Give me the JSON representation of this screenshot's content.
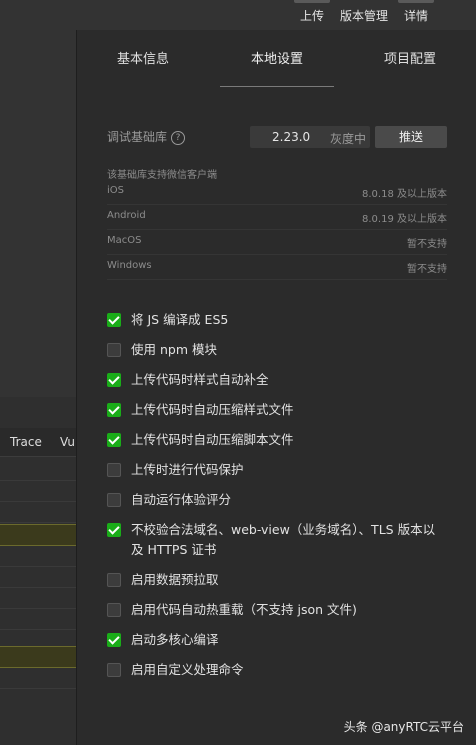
{
  "toolbar": {
    "upload_label": "上传",
    "version_label": "版本管理",
    "detail_label": "详情"
  },
  "left": {
    "tab_trace": "Trace",
    "tab_vu": "Vu"
  },
  "tabs": [
    {
      "label": "基本信息"
    },
    {
      "label": "本地设置"
    },
    {
      "label": "项目配置"
    }
  ],
  "sdk": {
    "label": "调试基础库",
    "help": "?",
    "version": "2.23.0",
    "gray": "灰度中",
    "push_label": "推送"
  },
  "support": {
    "title": "该基础库支持微信客户端",
    "rows": [
      {
        "name": "iOS",
        "status": "8.0.18 及以上版本"
      },
      {
        "name": "Android",
        "status": "8.0.19 及以上版本"
      },
      {
        "name": "MacOS",
        "status": "暂不支持"
      },
      {
        "name": "Windows",
        "status": "暂不支持"
      }
    ]
  },
  "options": [
    {
      "label": "将 JS 编译成 ES5",
      "checked": true
    },
    {
      "label": "使用 npm 模块",
      "checked": false
    },
    {
      "label": "上传代码时样式自动补全",
      "checked": true
    },
    {
      "label": "上传代码时自动压缩样式文件",
      "checked": true
    },
    {
      "label": "上传代码时自动压缩脚本文件",
      "checked": true
    },
    {
      "label": "上传时进行代码保护",
      "checked": false
    },
    {
      "label": "自动运行体验评分",
      "checked": false
    },
    {
      "label": "不校验合法域名、web-view（业务域名）、TLS 版本以及 HTTPS 证书",
      "checked": true
    },
    {
      "label": "启用数据预拉取",
      "checked": false
    },
    {
      "label": "启用代码自动热重载（不支持 json 文件)",
      "checked": false
    },
    {
      "label": "启动多核心编译",
      "checked": true
    },
    {
      "label": "启用自定义处理命令",
      "checked": false
    }
  ],
  "watermark": "头条 @anyRTC云平台",
  "colors": {
    "accent": "#1aad19"
  }
}
